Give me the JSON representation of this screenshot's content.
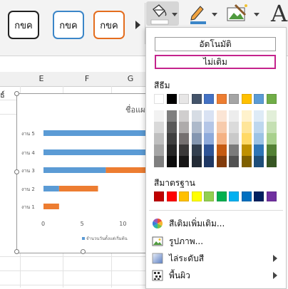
{
  "ribbon": {
    "shape_styles": [
      {
        "label": "กขค",
        "color": "#222222"
      },
      {
        "label": "กขค",
        "color": "#3b86c8"
      },
      {
        "label": "กขค",
        "color": "#e46d1e"
      }
    ],
    "buttons": [
      "paint-bucket-icon",
      "pen-icon",
      "effects-icon",
      "text-a-icon"
    ],
    "text_button_label": "A"
  },
  "sheet": {
    "columns": [
      "E",
      "F",
      "G"
    ],
    "cell_fragment": "ธ์"
  },
  "chart": {
    "title_fragment": "ชื่อแผ",
    "chart_data": {
      "type": "bar",
      "orientation": "horizontal",
      "stacked": true,
      "categories": [
        "งาน 1",
        "งาน 2",
        "งาน 3",
        "งาน 4",
        "งาน 5"
      ],
      "series": [
        {
          "name": "จำนวนวันตั้งแต่เริ่มต้น",
          "color": "#5b9bd5",
          "values": [
            0,
            2,
            8,
            14,
            14
          ]
        },
        {
          "name": "",
          "color": "#ed7d31",
          "values": [
            2,
            5,
            6,
            0,
            0
          ]
        }
      ],
      "x_ticks": [
        "0",
        "5",
        "10"
      ],
      "xlim": [
        0,
        14
      ],
      "legend_position": "bottom",
      "legend_text": "จำนวนวันตั้งแต่เริ่มต้น"
    }
  },
  "menu": {
    "auto_label": "อัตโนมัติ",
    "no_fill_label": "ไม่เติม",
    "theme_colors_label": "สีธีม",
    "theme_top": [
      "#ffffff",
      "#000000",
      "#e7e6e6",
      "#44546a",
      "#4472c4",
      "#ed7d31",
      "#a5a5a5",
      "#ffc000",
      "#5b9bd5",
      "#70ad47"
    ],
    "theme_shades": [
      [
        "#f2f2f2",
        "#7f7f7f",
        "#d0cece",
        "#d6dce4",
        "#d9e2f3",
        "#fbe5d5",
        "#ededed",
        "#fff2cc",
        "#deebf6",
        "#e2efd9"
      ],
      [
        "#d9d9d9",
        "#595959",
        "#aeabab",
        "#adb9ca",
        "#b4c6e7",
        "#f7cbac",
        "#dbdbdb",
        "#fee599",
        "#bdd7ee",
        "#c5e0b3"
      ],
      [
        "#bfbfbf",
        "#3f3f3f",
        "#757070",
        "#8496b0",
        "#8eaadb",
        "#f4b183",
        "#c9c9c9",
        "#ffd965",
        "#9cc3e5",
        "#a8d08d"
      ],
      [
        "#a5a5a5",
        "#262626",
        "#3a3838",
        "#323f4f",
        "#2f5496",
        "#c55a11",
        "#7b7b7b",
        "#bf9000",
        "#2e75b5",
        "#538135"
      ],
      [
        "#7f7f7f",
        "#0c0c0c",
        "#171616",
        "#222a35",
        "#1f3864",
        "#833c0b",
        "#525252",
        "#7f6000",
        "#1e4e79",
        "#375623"
      ]
    ],
    "standard_colors_label": "สีมาตรฐาน",
    "standard_colors": [
      "#c00000",
      "#ff0000",
      "#ffc000",
      "#ffff00",
      "#92d050",
      "#00b050",
      "#00b0f0",
      "#0070c0",
      "#002060",
      "#7030a0"
    ],
    "items": [
      {
        "label": "สีเติมเพิ่มเติม...",
        "icon": "color-wheel-icon",
        "has_submenu": false
      },
      {
        "label": "รูปภาพ...",
        "icon": "picture-icon",
        "has_submenu": false
      },
      {
        "label": "ไล่ระดับสี",
        "icon": "gradient-icon",
        "has_submenu": true
      },
      {
        "label": "พื้นผิว",
        "icon": "texture-icon",
        "has_submenu": true
      }
    ]
  }
}
